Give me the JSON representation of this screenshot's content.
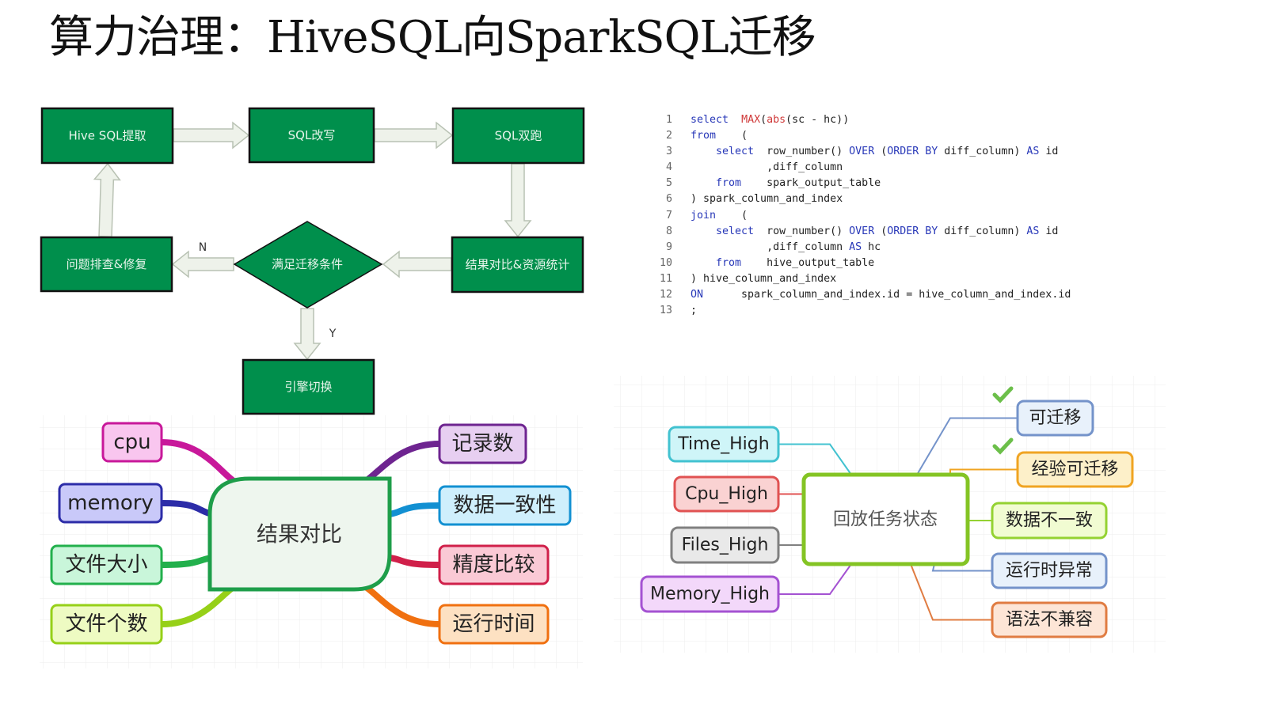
{
  "title": "算力治理：HiveSQL向SparkSQL迁移",
  "flowchart": {
    "fill": "#008f4c",
    "arrow_fill": "#eef2ea",
    "nodes": {
      "extract": "Hive SQL提取",
      "rewrite": "SQL改写",
      "dual_run": "SQL双跑",
      "compare": "结果对比&资源统计",
      "condition": "满足迁移条件",
      "fix": "问题排查&修复",
      "switch": "引擎切换"
    },
    "labels": {
      "no": "N",
      "yes": "Y"
    }
  },
  "code": {
    "lines": [
      {
        "n": "1",
        "segs": [
          [
            "k",
            "select"
          ],
          [
            "p",
            "  "
          ],
          [
            "f",
            "MAX"
          ],
          [
            "p",
            "("
          ],
          [
            "f",
            "abs"
          ],
          [
            "p",
            "(sc - hc))"
          ]
        ]
      },
      {
        "n": "2",
        "segs": [
          [
            "k",
            "from"
          ],
          [
            "p",
            "    ("
          ]
        ]
      },
      {
        "n": "3",
        "segs": [
          [
            "p",
            "    "
          ],
          [
            "k",
            "select"
          ],
          [
            "p",
            "  row_number() "
          ],
          [
            "k",
            "OVER"
          ],
          [
            "p",
            " ("
          ],
          [
            "k",
            "ORDER BY"
          ],
          [
            "p",
            " diff_column) "
          ],
          [
            "k",
            "AS"
          ],
          [
            "p",
            " id"
          ]
        ]
      },
      {
        "n": "4",
        "segs": [
          [
            "p",
            "            ,diff_column"
          ]
        ]
      },
      {
        "n": "5",
        "segs": [
          [
            "p",
            "    "
          ],
          [
            "k",
            "from"
          ],
          [
            "p",
            "    spark_output_table"
          ]
        ]
      },
      {
        "n": "6",
        "segs": [
          [
            "p",
            ") spark_column_and_index"
          ]
        ]
      },
      {
        "n": "7",
        "segs": [
          [
            "k",
            "join"
          ],
          [
            "p",
            "    ("
          ]
        ]
      },
      {
        "n": "8",
        "segs": [
          [
            "p",
            "    "
          ],
          [
            "k",
            "select"
          ],
          [
            "p",
            "  row_number() "
          ],
          [
            "k",
            "OVER"
          ],
          [
            "p",
            " ("
          ],
          [
            "k",
            "ORDER BY"
          ],
          [
            "p",
            " diff_column) "
          ],
          [
            "k",
            "AS"
          ],
          [
            "p",
            " id"
          ]
        ]
      },
      {
        "n": "9",
        "segs": [
          [
            "p",
            "            ,diff_column "
          ],
          [
            "k",
            "AS"
          ],
          [
            "p",
            " hc"
          ]
        ]
      },
      {
        "n": "10",
        "segs": [
          [
            "p",
            "    "
          ],
          [
            "k",
            "from"
          ],
          [
            "p",
            "    hive_output_table"
          ]
        ]
      },
      {
        "n": "11",
        "segs": [
          [
            "p",
            ") hive_column_and_index"
          ]
        ]
      },
      {
        "n": "12",
        "segs": [
          [
            "k",
            "ON"
          ],
          [
            "p",
            "      spark_column_and_index.id = hive_column_and_index.id"
          ]
        ]
      },
      {
        "n": "13",
        "segs": [
          [
            "p",
            ";"
          ]
        ]
      }
    ]
  },
  "mindmap_compare": {
    "center": "结果对比",
    "center_fill": "#eef6ee",
    "center_stroke": "#1e9e4a",
    "left": [
      {
        "label": "cpu",
        "fill": "#f9c6ef",
        "stroke": "#c8189a"
      },
      {
        "label": "memory",
        "fill": "#c9c9f9",
        "stroke": "#2c2ca8"
      },
      {
        "label": "文件大小",
        "fill": "#c9f6da",
        "stroke": "#22b04c"
      },
      {
        "label": "文件个数",
        "fill": "#eefbc2",
        "stroke": "#96d018"
      }
    ],
    "right": [
      {
        "label": "记录数",
        "fill": "#e7cff1",
        "stroke": "#6e2490"
      },
      {
        "label": "数据一致性",
        "fill": "#cfeffc",
        "stroke": "#1290d2"
      },
      {
        "label": "精度比较",
        "fill": "#fac9d5",
        "stroke": "#d0204a"
      },
      {
        "label": "运行时间",
        "fill": "#fde1c2",
        "stroke": "#f07010"
      }
    ]
  },
  "mindmap_status": {
    "center": "回放任务状态",
    "center_stroke": "#84c424",
    "check_icon": "check-icon",
    "check_color": "#6cbf4a",
    "left": [
      {
        "label": "Time_High",
        "fill": "#cff5f8",
        "stroke": "#42c2d0"
      },
      {
        "label": "Cpu_High",
        "fill": "#fad2d2",
        "stroke": "#e05252"
      },
      {
        "label": "Files_High",
        "fill": "#e9e9e9",
        "stroke": "#808080"
      },
      {
        "label": "Memory_High",
        "fill": "#f3d8fa",
        "stroke": "#a452d2"
      }
    ],
    "right": [
      {
        "label": "可迁移",
        "fill": "#e8f1fb",
        "stroke": "#7493ca",
        "checked": true
      },
      {
        "label": "经验可迁移",
        "fill": "#fdf0c9",
        "stroke": "#f0a422",
        "checked": true
      },
      {
        "label": "数据不一致",
        "fill": "#f1fcd2",
        "stroke": "#94d232"
      },
      {
        "label": "运行时异常",
        "fill": "#e8f1fb",
        "stroke": "#7493ca"
      },
      {
        "label": "语法不兼容",
        "fill": "#fde5d6",
        "stroke": "#e07c42"
      }
    ]
  }
}
